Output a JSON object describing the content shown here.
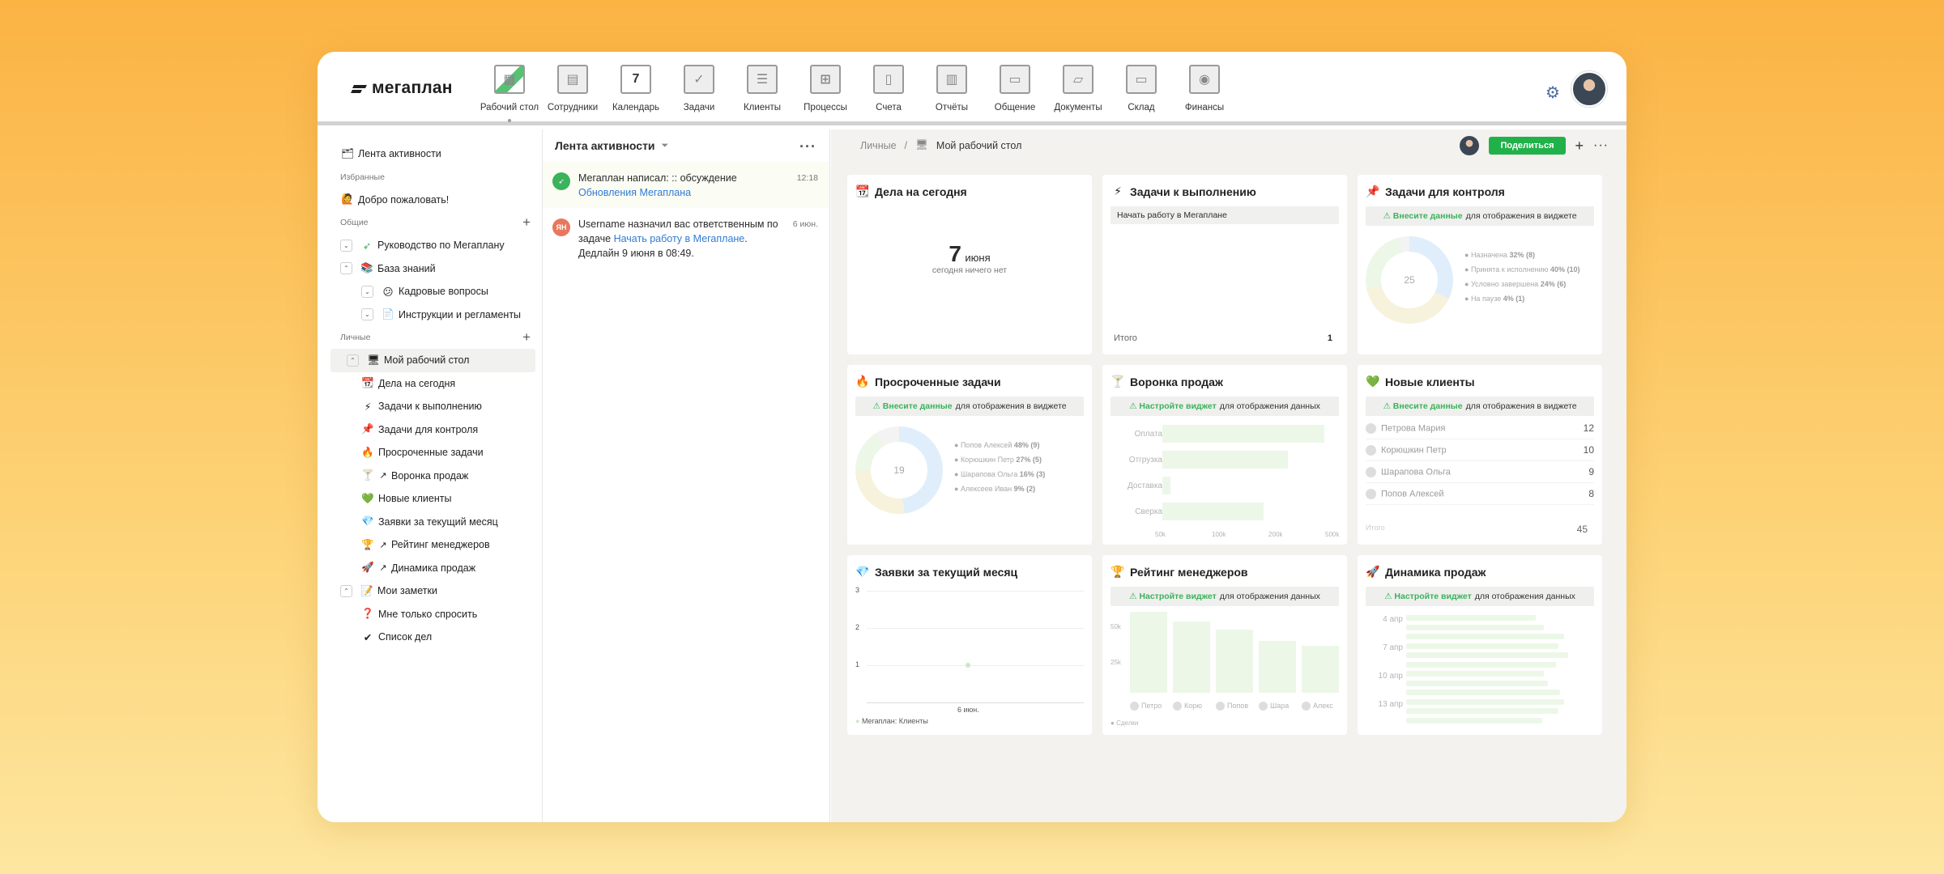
{
  "app": {
    "logo": "мегаплан"
  },
  "nav": [
    {
      "label": "Рабочий стол",
      "icon": "desktop-icon",
      "active": true
    },
    {
      "label": "Сотрудники",
      "icon": "employees-icon"
    },
    {
      "label": "Календарь",
      "icon": "calendar-icon",
      "day": "7"
    },
    {
      "label": "Задачи",
      "icon": "tasks-icon"
    },
    {
      "label": "Клиенты",
      "icon": "clients-icon"
    },
    {
      "label": "Процессы",
      "icon": "processes-icon"
    },
    {
      "label": "Счета",
      "icon": "invoices-icon"
    },
    {
      "label": "Отчёты",
      "icon": "reports-icon"
    },
    {
      "label": "Общение",
      "icon": "chat-icon"
    },
    {
      "label": "Документы",
      "icon": "documents-icon"
    },
    {
      "label": "Склад",
      "icon": "warehouse-icon"
    },
    {
      "label": "Финансы",
      "icon": "finance-icon"
    }
  ],
  "sidebar": {
    "feed": "Лента активности",
    "fav_section": "Избранные",
    "welcome": "Добро пожаловать!",
    "common_section": "Общие",
    "guide": "Руководство по Мегаплану",
    "kb": "База знаний",
    "hr": "Кадровые вопросы",
    "instr": "Инструкции и регламенты",
    "personal_section": "Личные",
    "desk": "Мой рабочий стол",
    "items": [
      "Дела на сегодня",
      "Задачи к выполнению",
      "Задачи для контроля",
      "Просроченные задачи",
      "Воронка продаж",
      "Новые клиенты",
      "Заявки за текущий месяц",
      "Рейтинг менеджеров",
      "Динамика продаж"
    ],
    "notes": "Мои заметки",
    "note1": "Мне только спросить",
    "note2": "Список дел"
  },
  "feed": {
    "title": "Лента активности",
    "items": [
      {
        "text": "Мегаплан написал: :: обсуждение",
        "link": "Обновления Мегаплана",
        "time": "12:18"
      },
      {
        "text1": "Username назначил вас ответственным по задаче ",
        "link": "Начать работу в Мегаплане",
        "text2": ". Дедлайн 9 июня в 08:49.",
        "time": "6 июн.",
        "avatar": "ЯН"
      }
    ]
  },
  "breadcrumb": {
    "root": "Личные",
    "sep": "/",
    "current": "Мой рабочий стол",
    "share": "Поделиться"
  },
  "widgets": {
    "today": {
      "title": "Дела на сегодня",
      "day": "7",
      "month": "июня",
      "empty": "сегодня ничего нет"
    },
    "todo": {
      "title": "Задачи к выполнению",
      "task": "Начать работу в Мегаплане",
      "total_label": "Итого",
      "total": "1"
    },
    "control": {
      "title": "Задачи для контроля",
      "warn_link": "⚠ Внесите данные",
      "warn_text": "для отображения в виджете",
      "center": "25",
      "legend": [
        {
          "name": "Назначена",
          "val": "32% (8)"
        },
        {
          "name": "Принята к исполнению",
          "val": "40% (10)"
        },
        {
          "name": "Условно завершена",
          "val": "24% (6)"
        },
        {
          "name": "На паузе",
          "val": "4% (1)"
        }
      ]
    },
    "overdue": {
      "title": "Просроченные задачи",
      "warn_link": "⚠ Внесите данные",
      "warn_text": "для отображения в виджете",
      "center": "19",
      "legend": [
        {
          "name": "Попов Алексей",
          "val": "48% (9)"
        },
        {
          "name": "Корюшкин Петр",
          "val": "27% (5)"
        },
        {
          "name": "Шарапова Ольга",
          "val": "16% (3)"
        },
        {
          "name": "Алексеев Иван",
          "val": "9% (2)"
        }
      ]
    },
    "funnel": {
      "title": "Воронка продаж",
      "warn_link": "⚠ Настройте виджет",
      "warn_text": "для отображения данных",
      "stages": [
        "Оплата",
        "Отгрузка",
        "Доставка",
        "Сверка"
      ],
      "ticks": [
        "50k",
        "100k",
        "200k",
        "500k"
      ]
    },
    "clients": {
      "title": "Новые клиенты",
      "warn_link": "⚠ Внесите данные",
      "warn_text": "для отображения в виджете",
      "rows": [
        {
          "name": "Петрова Мария",
          "n": "12"
        },
        {
          "name": "Корюшкин Петр",
          "n": "10"
        },
        {
          "name": "Шарапова Ольга",
          "n": "9"
        },
        {
          "name": "Попов Алексей",
          "n": "8"
        }
      ],
      "total_label": "Итого",
      "total": "45"
    },
    "requests": {
      "title": "Заявки за текущий месяц",
      "yticks": [
        "3",
        "2",
        "1"
      ],
      "xlabel": "6 июн.",
      "legend": "Мегаплан: Клиенты"
    },
    "rating": {
      "title": "Рейтинг менеджеров",
      "warn_link": "⚠ Настройте виджет",
      "warn_text": "для отображения данных",
      "yticks": [
        "50k",
        "25k"
      ],
      "names": [
        "Петро",
        "Корю",
        "Попов",
        "Шара",
        "Алекс"
      ],
      "legend": "Сделки"
    },
    "dynamics": {
      "title": "Динамика продаж",
      "warn_link": "⚠ Настройте виджет",
      "warn_text": "для отображения данных",
      "dates": [
        "4 апр",
        "7 апр",
        "10 апр",
        "13 апр"
      ]
    }
  }
}
